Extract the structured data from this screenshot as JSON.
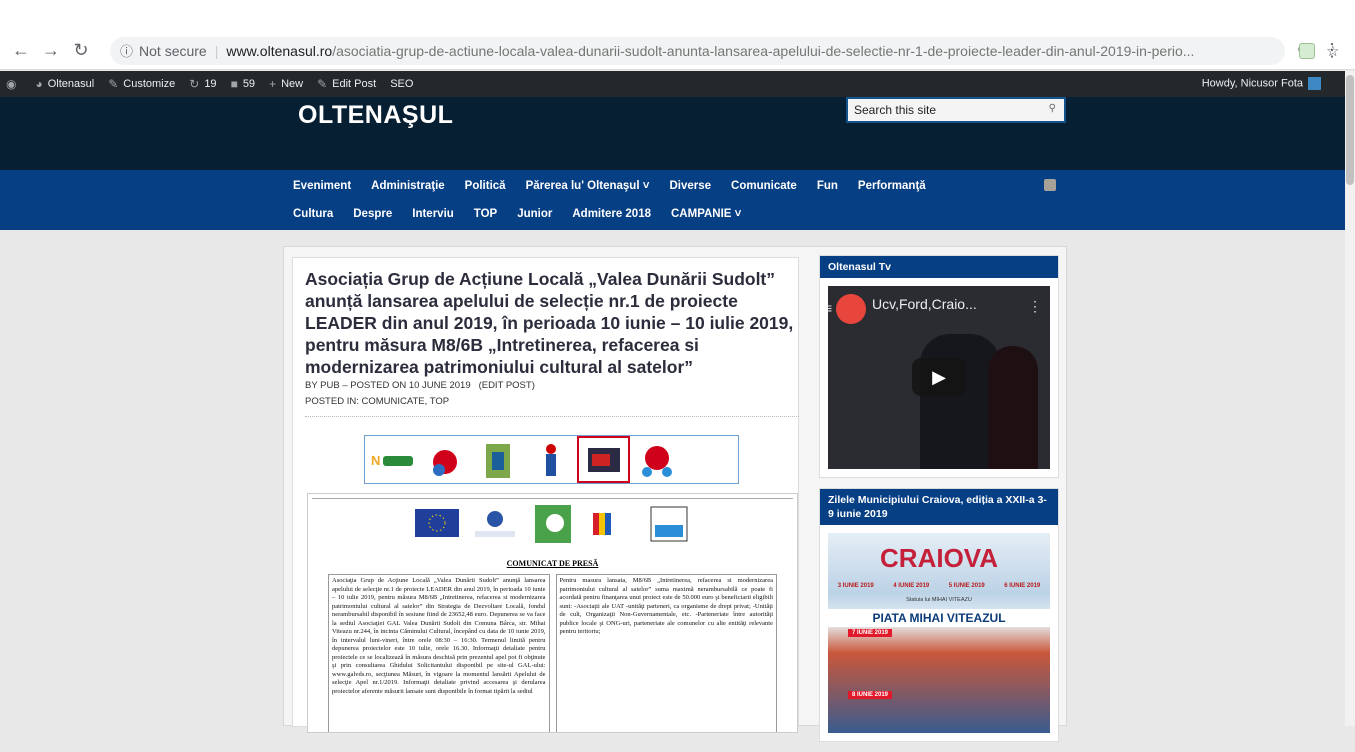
{
  "browser": {
    "not_secure": "Not secure",
    "domain": "www.oltenasul.ro",
    "path": "/asociatia-grup-de-actiune-locala-valea-dunarii-sudolt-anunta-lansarea-apelului-de-selectie-nr-1-de-proiecte-leader-din-anul-2019-in-perio..."
  },
  "wpbar": {
    "site": "Oltenasul",
    "customize": "Customize",
    "updates": "19",
    "comments": "59",
    "new": "New",
    "edit_post": "Edit Post",
    "seo": "SEO",
    "howdy": "Howdy, Nicusor Fota"
  },
  "site": {
    "logo": "OLTENAŞUL",
    "search_placeholder": "Search this site"
  },
  "nav": {
    "row1": [
      "Eveniment",
      "Administraţie",
      "Politică",
      "Părerea lu' Oltenaşul ˅",
      "Diverse",
      "Comunicate",
      "Fun",
      "Performanţă"
    ],
    "row2": [
      "Cultura",
      "Despre",
      "Interviu",
      "TOP",
      "Junior",
      "Admitere 2018",
      "CAMPANIE ˅"
    ]
  },
  "article": {
    "title": "Asociația Grup de Acțiune Locală „Valea Dunării Sudolt” anunță lansarea apelului de selecție nr.1 de proiecte LEADER din anul 2019, în perioada 10 iunie – 10 iulie 2019, pentru măsura M8/6B „Intretinerea, refacerea si modernizarea patrimoniului cultural al satelor”",
    "by": "BY PUB",
    "posted": "– POSTED ON 10 JUNE 2019",
    "edit": "(EDIT POST)",
    "posted_in_label": "POSTED IN:",
    "categories": "COMUNICATE, TOP"
  },
  "document": {
    "heading": "COMUNICAT DE PRESĂ",
    "col1": "Asociaţia Grup de Acţiune Locală „Valea Dunării Sudolt” anunţă lansarea apelului de selecţie nr.1 de proiecte LEADER din anul 2019, în perioada 10 iunie – 10 iulie 2019, pentru măsura M8/6B „Intretinerea, refacerea si modernizarea patrimoniului cultural al satelor” din Strategia de Dezvoltare Locală, fondul nerambursabil disponibil în sesiune fiind de 23652,48 euro. Depunerea se va face la sediul Asociaţiei GAL Valea Dunării Sudolt din Comuna Bârca, str. Mihai Viteazu nr.244, în incinta Căminului Cultural, începând cu data de 10 iunie 2019, în intervalul luni-vineri, între orele 08:30 – 16:30. Termenul limită pentru depunerea proiectelor este 10 iulie, orele 16.30. Informaţii detaliate pentru proiectele ce se localizează în măsura deschisă prin prezentul apel pot fi obţinute şi prin consultarea Ghidului Solicitantului disponibil pe site-ul GAL-ului: www.galvds.ro, secţiunea Măsuri, în vigoare la momentul lansării Apelului de selecţie Apel nr.1/2019. Informaţii detaliate privind accesarea şi derularea proiectelor aferente măsurii lansate sunt disponibile în format tipărit la sediul",
    "col2": "Pentru masura lansata, M8/6B „Intretinerea, refacerea si modernizarea patrimoniului cultural al satelor” suma maximă nerambursabilă ce poate fi acordată pentru finanţarea unui proiect este de 50.000 euro şi beneficiarii eligibili sunt: -Asociaţii ale UAT -unităţi parteneri, ca organisme de drept privat; -Unităţi de cult, Organizaţii Non-Guvernamentale, etc. -Parteneriate între autorităţi publice locale şi ONG-uri, parteneriate ale comunelor cu alte entităţi relevante pentru teritoriu;"
  },
  "sidebar": {
    "tv_title": "Oltenasul Tv",
    "video_title": "Ucv,Ford,Craio...",
    "event_title": "Zilele Municipiului Craiova, ediția a XXII-a 3-9 iunie 2019",
    "poster_title": "CRAIOVA",
    "poster_place": "PIATA MIHAI VITEAZUL",
    "poster_day1": "7 IUNIE 2019",
    "poster_day2": "8 IUNIE 2019",
    "poster_dates": [
      "3 IUNIE 2019",
      "4 IUNIE 2019",
      "5 IUNIE 2019",
      "6 IUNIE 2019"
    ],
    "poster_stage": "Statuia lui MIHAI VITEAZU"
  }
}
